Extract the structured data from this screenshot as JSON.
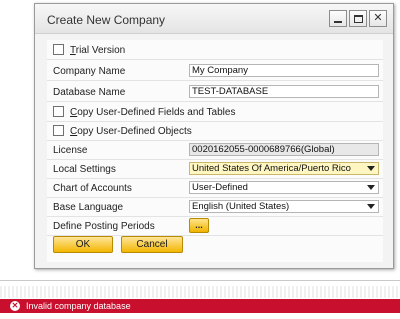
{
  "dialog": {
    "title": "Create New Company",
    "trial_version": {
      "label_prefix": "",
      "label_mnemonic": "T",
      "label_rest": "rial Version",
      "checked": false
    },
    "company_name": {
      "label": "Company Name",
      "value": "My Company"
    },
    "database_name": {
      "label": "Database Name",
      "value": "TEST-DATABASE"
    },
    "copy_udf": {
      "label_mnemonic": "C",
      "label_rest": "opy User-Defined Fields and Tables",
      "checked": false
    },
    "copy_udo": {
      "label_mnemonic": "C",
      "label_rest": "opy User-Defined Objects",
      "checked": false
    },
    "license": {
      "label": "License",
      "value": "0020162055-0000689766(Global)"
    },
    "local_settings": {
      "label": "Local Settings",
      "value": "United States Of America/Puerto Rico"
    },
    "chart_of_accounts": {
      "label": "Chart of Accounts",
      "value": "User-Defined"
    },
    "base_language": {
      "label": "Base Language",
      "value": "English (United States)"
    },
    "posting_periods": {
      "label": "Define Posting Periods",
      "button_label": "..."
    },
    "ok_label": "OK",
    "cancel_label": "Cancel"
  },
  "window_controls": {
    "close_glyph": "✕"
  },
  "status_bar": {
    "icon_glyph": "✕",
    "message": "Invalid company database",
    "color": "#c8102e"
  }
}
